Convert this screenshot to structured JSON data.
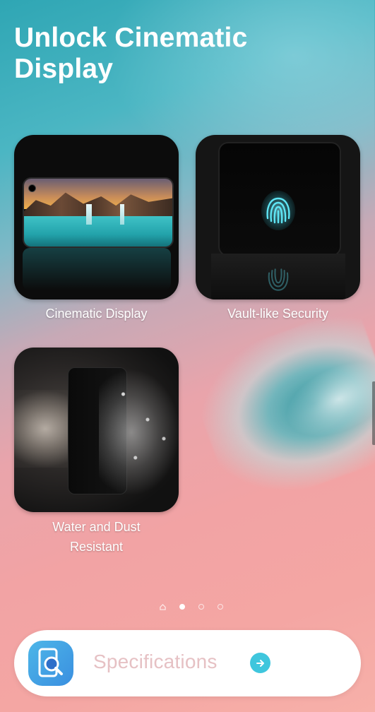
{
  "header": {
    "title_line1": "Unlock Cinematic",
    "title_line2": "Display"
  },
  "features": [
    {
      "label": "Cinematic Display"
    },
    {
      "label": "Vault-like Security"
    },
    {
      "label_line1": "Water and Dust",
      "label_line2": "Resistant"
    }
  ],
  "pager": {
    "pages": 4,
    "active_index": 1
  },
  "bottom_bar": {
    "label": "Specifications",
    "icon": "phone-search-icon",
    "action_icon": "arrow-right-icon"
  },
  "colors": {
    "accent": "#3fc6dd",
    "icon_blue": "#3a8fe0",
    "label_pink": "#e6c1c4"
  }
}
